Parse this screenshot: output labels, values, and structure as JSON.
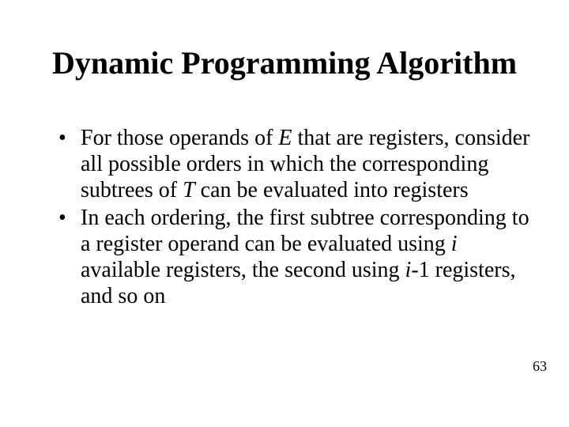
{
  "slide": {
    "title": "Dynamic Programming Algorithm",
    "bullets": [
      {
        "seg1": "For those operands of ",
        "var1": "E",
        "seg2": " that are registers, consider all possible orders in which the corresponding subtrees of ",
        "var2": "T",
        "seg3": " can be evaluated into registers"
      },
      {
        "seg1": "In each ordering, the first subtree corresponding to a register operand can be evaluated using ",
        "var1": "i",
        "seg2": " available registers, the second using ",
        "var2": "i",
        "seg3": "-1 registers, and so on"
      }
    ],
    "page_number": "63"
  }
}
